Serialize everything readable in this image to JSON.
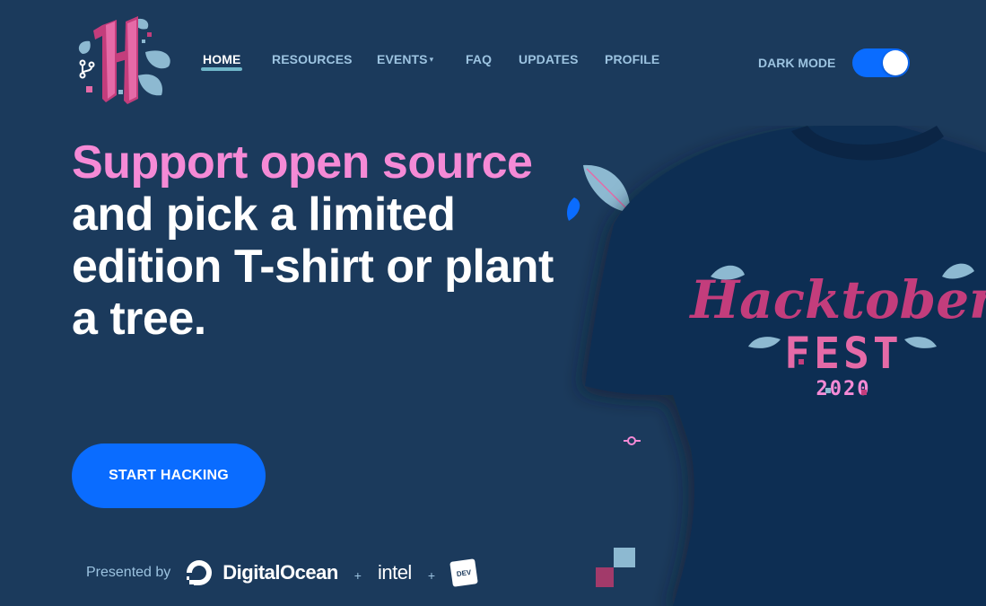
{
  "nav": {
    "items": [
      {
        "label": "HOME",
        "active": true
      },
      {
        "label": "RESOURCES",
        "active": false
      },
      {
        "label": "EVENTS",
        "active": false,
        "caret": "▾"
      },
      {
        "label": "FAQ",
        "active": false
      },
      {
        "label": "UPDATES",
        "active": false
      },
      {
        "label": "PROFILE",
        "active": false
      }
    ]
  },
  "dark_mode": {
    "label": "DARK MODE",
    "enabled": true
  },
  "hero": {
    "highlight": "Support open source",
    "rest": " and pick a limited edition T-shirt or plant a tree."
  },
  "cta": {
    "label": "START HACKING"
  },
  "sponsors": {
    "prefix": "Presented by",
    "digitalocean": "DigitalOcean",
    "plus": "+",
    "intel": "intel",
    "dev": "DEV"
  },
  "shirt": {
    "line1": "Hacktober",
    "line2": "FEST",
    "line3": "2020"
  },
  "colors": {
    "background": "#1b3a5c",
    "accent_pink": "#f58ad6",
    "accent_blue": "#0a6cff",
    "nav_text": "#9cc3e0"
  },
  "icons": {
    "logo": "hacktoberfest-h-logo",
    "git_branch": "git-branch-icon",
    "git_commit": "git-commit-icon",
    "digitalocean": "digitalocean-logo",
    "leaf": "leaf-icon"
  }
}
